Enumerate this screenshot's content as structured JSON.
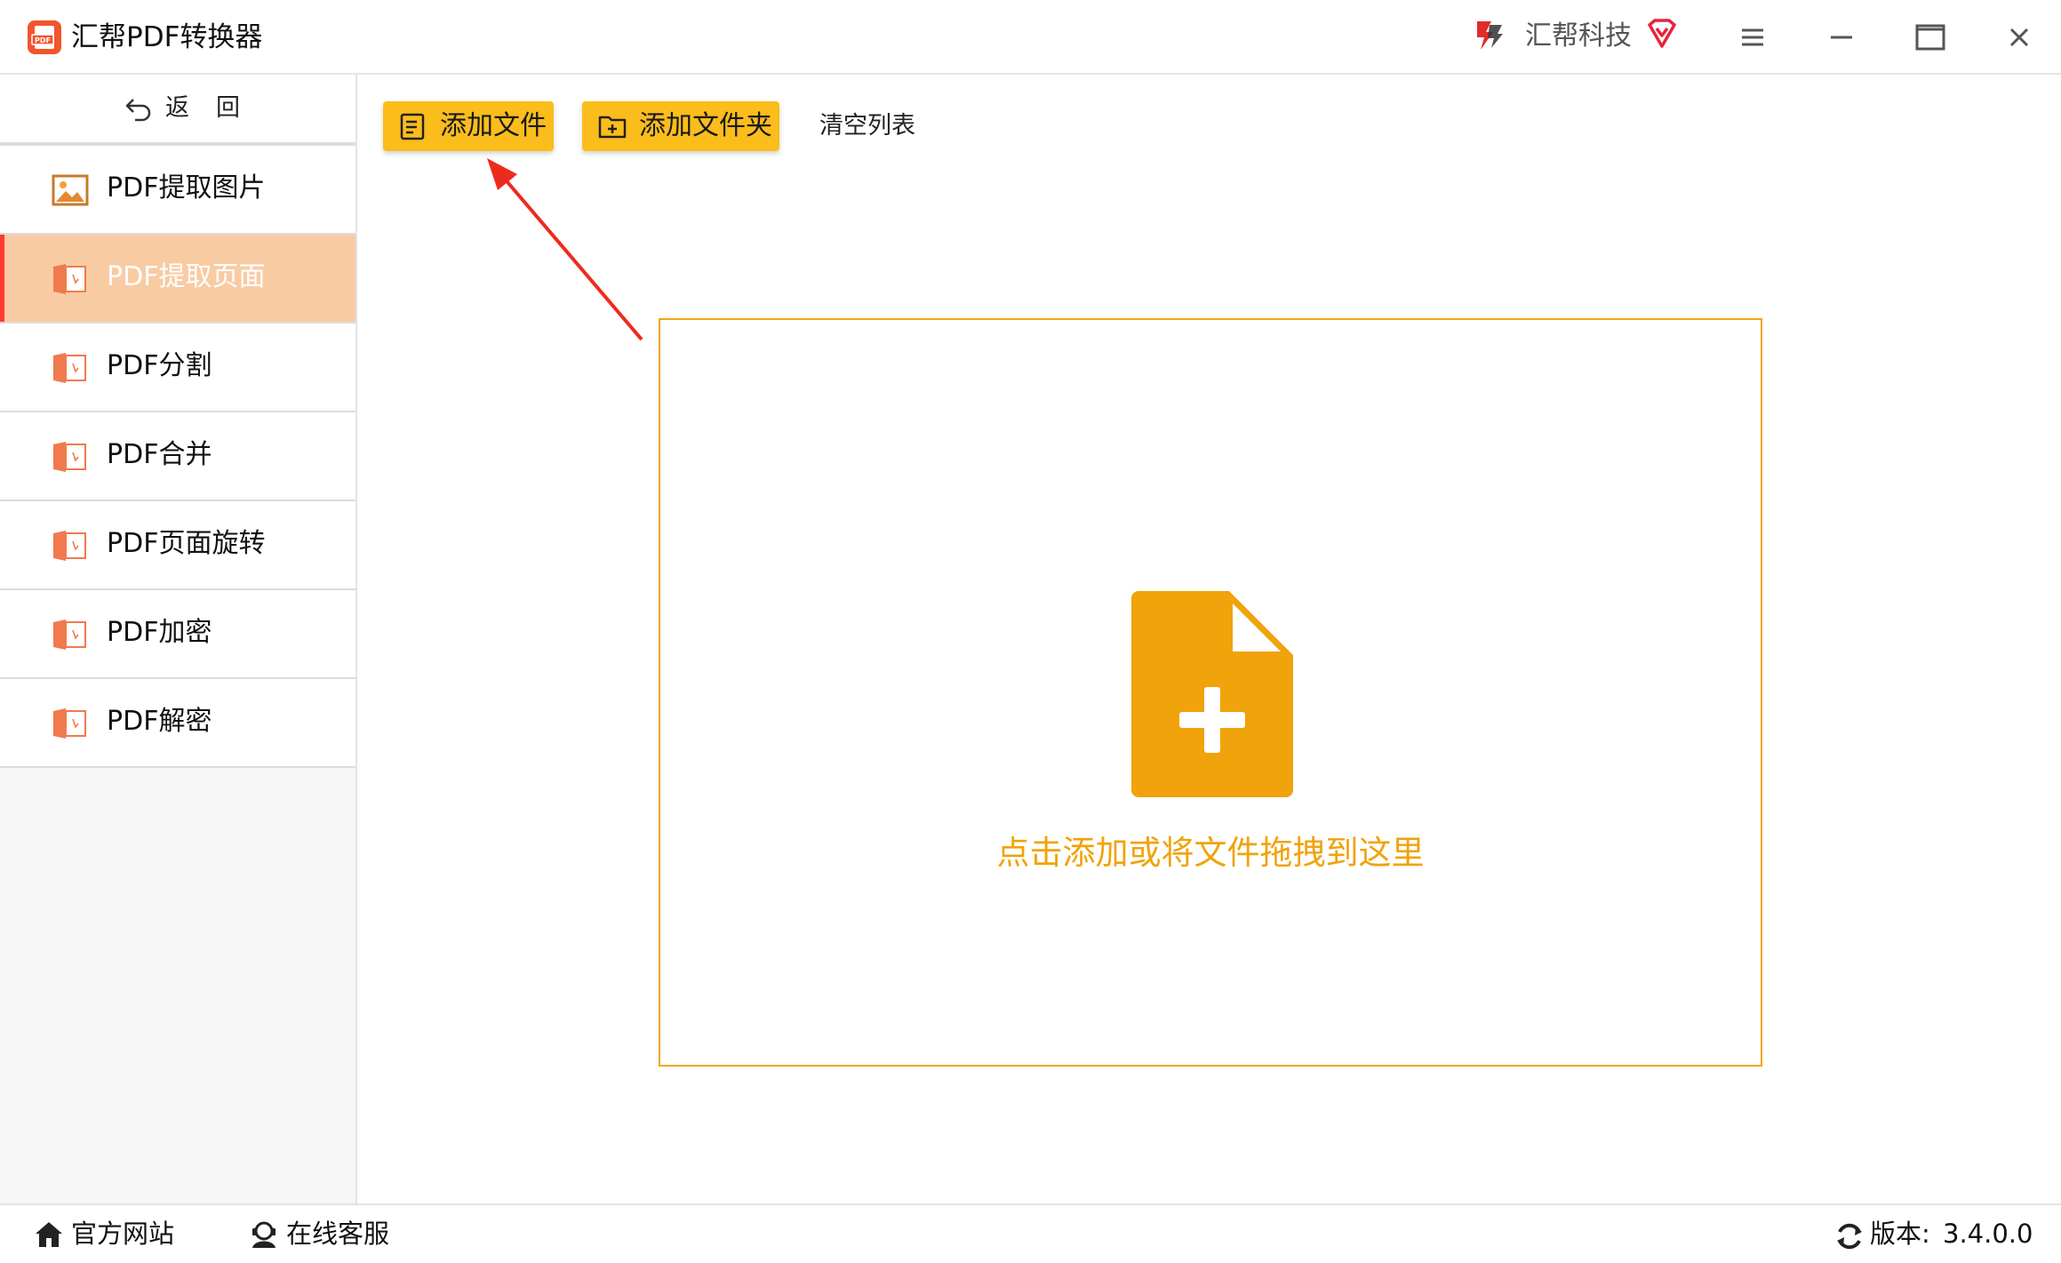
{
  "app": {
    "title": "汇帮PDF转换器",
    "brand_name": "汇帮科技",
    "logo_icon": "pdf-logo-icon",
    "accent_color": "#fbbd1c",
    "active_color": "#f8cba3"
  },
  "sidebar": {
    "back_label": "返回",
    "items": [
      {
        "label": "PDF提取图片",
        "icon": "image-icon",
        "active": false
      },
      {
        "label": "PDF提取页面",
        "icon": "pdf-file-icon",
        "active": true
      },
      {
        "label": "PDF分割",
        "icon": "pdf-file-icon",
        "active": false
      },
      {
        "label": "PDF合并",
        "icon": "pdf-file-icon",
        "active": false
      },
      {
        "label": "PDF页面旋转",
        "icon": "pdf-file-icon",
        "active": false
      },
      {
        "label": "PDF加密",
        "icon": "pdf-file-icon",
        "active": false
      },
      {
        "label": "PDF解密",
        "icon": "pdf-file-icon",
        "active": false
      }
    ]
  },
  "toolbar": {
    "add_file_label": "添加文件",
    "add_folder_label": "添加文件夹",
    "clear_list_label": "清空列表"
  },
  "drop_zone": {
    "hint": "点击添加或将文件拖拽到这里",
    "border_color": "#f2a60f",
    "icon_color": "#f0a30a"
  },
  "status_bar": {
    "website_label": "官方网站",
    "support_label": "在线客服",
    "version_label": "版本:",
    "version_value": "3.4.0.0"
  }
}
